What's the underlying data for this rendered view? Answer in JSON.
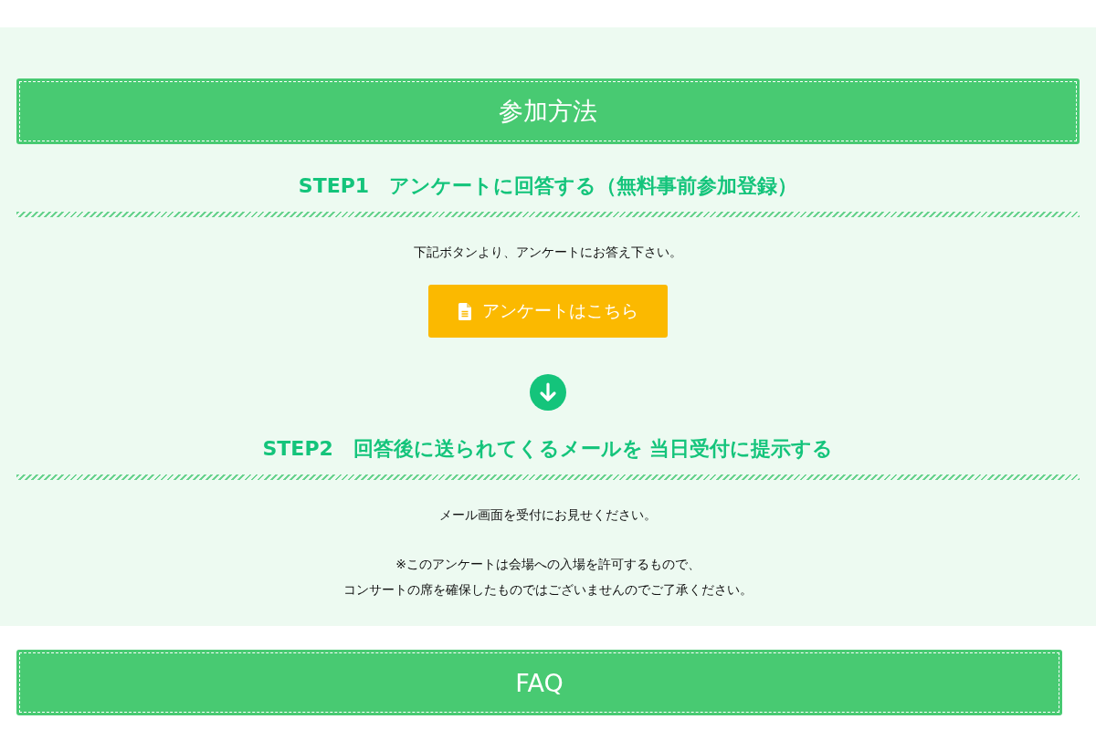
{
  "section": {
    "title": "参加方法",
    "steps": [
      {
        "heading": "STEP1　アンケートに回答する（無料事前参加登録）",
        "text": "下記ボタンより、アンケートにお答え下さい。",
        "button": "アンケートはこちら"
      },
      {
        "heading": "STEP2　回答後に送られてくるメールを 当日受付に提示する",
        "text": "メール画面を受付にお見せください。",
        "note_lines": [
          "※このアンケートは会場への入場を許可するもので、",
          "コンサートの席を確保したものではございませんのでご了承ください。"
        ]
      }
    ]
  },
  "faq": {
    "title": "FAQ"
  }
}
